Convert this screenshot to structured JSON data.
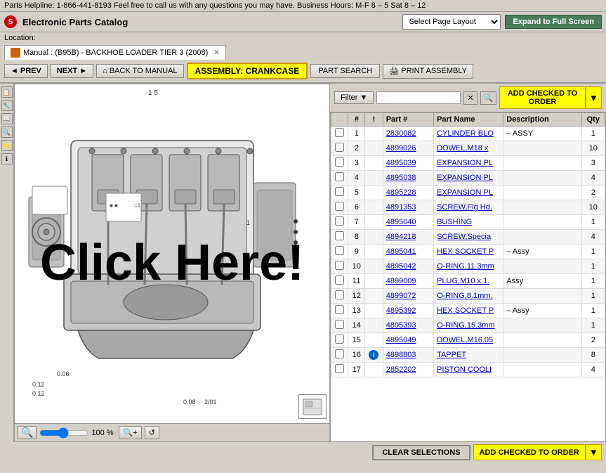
{
  "topbar": {
    "helpline": "Parts Helpline: 1-866-441-8193  Feel free to call us with any questions you may have.  Business Hours: M-F 8 – 5  Sat 8 – 12"
  },
  "titlebar": {
    "logo": "S",
    "app_title": "Electronic Parts Catalog",
    "layout_placeholder": "Select Page Layout",
    "expand_btn": "Expand to Full Screen"
  },
  "location": {
    "label": "Location:"
  },
  "manual_tab": {
    "label": "Manual : (B95B) - BACKHOE LOADER TIER 3 (2008)"
  },
  "toolbar": {
    "prev_btn": "◄ PREV",
    "next_btn": "NEXT ►",
    "back_manual_btn": "BACK TO MANUAL",
    "assembly_btn": "ASSEMBLY: CRANKCASE",
    "part_search_btn": "PART SEARCH",
    "print_btn": "PRINT ASSEMBLY"
  },
  "filter": {
    "label": "Filter",
    "placeholder": "",
    "add_checked_btn": "ADD CHECKED TO ORDER"
  },
  "table": {
    "headers": [
      "",
      "#",
      "!",
      "Part #",
      "Part Name",
      "Description",
      "Qty"
    ],
    "rows": [
      {
        "num": "1",
        "bang": "",
        "part_num": "2830082",
        "part_name": "CYLINDER BLO",
        "description": "– ASSY",
        "qty": "1",
        "info": false
      },
      {
        "num": "2",
        "bang": "",
        "part_num": "4899026",
        "part_name": "DOWEL,M18 x",
        "description": "",
        "qty": "10",
        "info": false
      },
      {
        "num": "3",
        "bang": "",
        "part_num": "4895039",
        "part_name": "EXPANSION PL",
        "description": "",
        "qty": "3",
        "info": false
      },
      {
        "num": "4",
        "bang": "",
        "part_num": "4895038",
        "part_name": "EXPANSION PL",
        "description": "",
        "qty": "4",
        "info": false
      },
      {
        "num": "5",
        "bang": "",
        "part_num": "4895228",
        "part_name": "EXPANSION PL",
        "description": "",
        "qty": "2",
        "info": false
      },
      {
        "num": "6",
        "bang": "",
        "part_num": "4891353",
        "part_name": "SCREW,Flg Hd,",
        "description": "",
        "qty": "10",
        "info": false
      },
      {
        "num": "7",
        "bang": "",
        "part_num": "4895040",
        "part_name": "BUSHING",
        "description": "",
        "qty": "1",
        "info": false
      },
      {
        "num": "8",
        "bang": "",
        "part_num": "4894218",
        "part_name": "SCREW,Specia",
        "description": "",
        "qty": "4",
        "info": false
      },
      {
        "num": "9",
        "bang": "",
        "part_num": "4895041",
        "part_name": "HEX SOCKET P",
        "description": "– Assy",
        "qty": "1",
        "info": false
      },
      {
        "num": "10",
        "bang": "",
        "part_num": "4895042",
        "part_name": "O-RING,11.3mm",
        "description": "",
        "qty": "1",
        "info": false
      },
      {
        "num": "11",
        "bang": "",
        "part_num": "4899009",
        "part_name": "PLUG,M10 x 1.",
        "description": "Assy",
        "qty": "1",
        "info": false
      },
      {
        "num": "12",
        "bang": "",
        "part_num": "4899072",
        "part_name": "O-RING,8.1mm,",
        "description": "",
        "qty": "1",
        "info": false
      },
      {
        "num": "13",
        "bang": "",
        "part_num": "4895392",
        "part_name": "HEX SOCKET P",
        "description": "– Assy",
        "qty": "1",
        "info": false
      },
      {
        "num": "14",
        "bang": "",
        "part_num": "4895393",
        "part_name": "O-RING,15.3mm",
        "description": "",
        "qty": "1",
        "info": false
      },
      {
        "num": "15",
        "bang": "",
        "part_num": "4895049",
        "part_name": "DOWEL,M16.05",
        "description": "",
        "qty": "2",
        "info": false
      },
      {
        "num": "16",
        "bang": "!",
        "part_num": "4898803",
        "part_name": "TAPPET",
        "description": "",
        "qty": "8",
        "info": true
      },
      {
        "num": "17",
        "bang": "",
        "part_num": "2852202",
        "part_name": "PISTON COOLI",
        "description": "",
        "qty": "4",
        "info": false
      }
    ]
  },
  "zoom": {
    "percent": "100 %"
  },
  "bottom": {
    "clear_btn": "CLEAR SELECTIONS",
    "add_checked_btn": "ADD CHECKED TO ORDER"
  },
  "click_overlay": "Click Here!"
}
